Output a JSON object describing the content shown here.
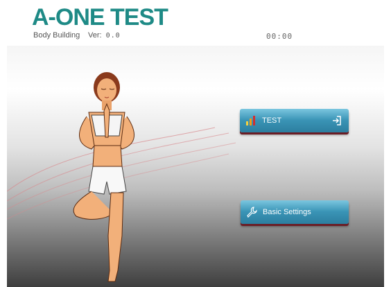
{
  "header": {
    "title": "A-ONE TEST",
    "subtitle": "Body Building",
    "version_label": "Ver:",
    "version_value": "0.0",
    "timer": "00:00"
  },
  "buttons": {
    "test_label": "TEST",
    "settings_label": "Basic Settings"
  },
  "icons": {
    "test": "bar-chart-icon",
    "test_action": "login-icon",
    "settings": "wrench-icon"
  },
  "colors": {
    "brand": "#1e8a86",
    "button": "#3a94b6",
    "button_shadow": "#6b1d25"
  }
}
